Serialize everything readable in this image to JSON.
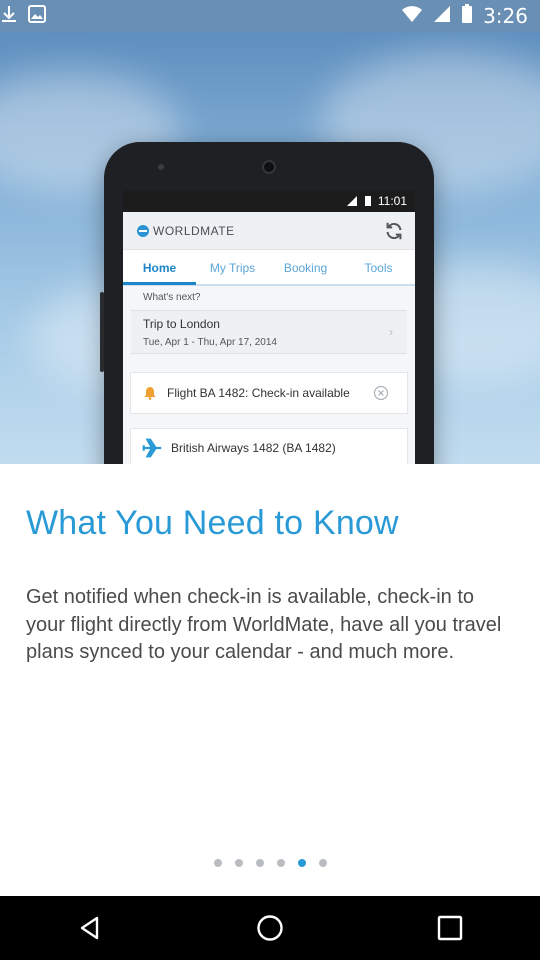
{
  "status_bar": {
    "time": "3:26"
  },
  "phone_screen": {
    "status_time": "11:01",
    "app_logo": "WORLDMATE",
    "tabs": [
      {
        "label": "Home",
        "active": true
      },
      {
        "label": "My Trips",
        "active": false
      },
      {
        "label": "Booking",
        "active": false
      },
      {
        "label": "Tools",
        "active": false
      }
    ],
    "whats_next": "What's next?",
    "trip": {
      "title": "Trip to London",
      "dates": "Tue, Apr 1 - Thu, Apr 17, 2014"
    },
    "notification": "Flight BA 1482: Check-in available",
    "flight": "British Airways 1482 (BA 1482)"
  },
  "content": {
    "headline": "What You Need to Know",
    "body": "Get notified when check-in is available, check-in to your flight directly from WorldMate, have all you travel plans synced to your calendar - and much more."
  },
  "pager": {
    "count": 6,
    "active_index": 4
  },
  "colors": {
    "accent": "#2a9ad6",
    "status_bar": "#6a8fb5",
    "nav_bar": "#000000"
  },
  "icons": {
    "status": [
      "download-icon",
      "image-icon",
      "wifi-icon",
      "signal-icon",
      "battery-icon"
    ],
    "nav": [
      "back-icon",
      "home-icon",
      "recents-icon"
    ]
  }
}
